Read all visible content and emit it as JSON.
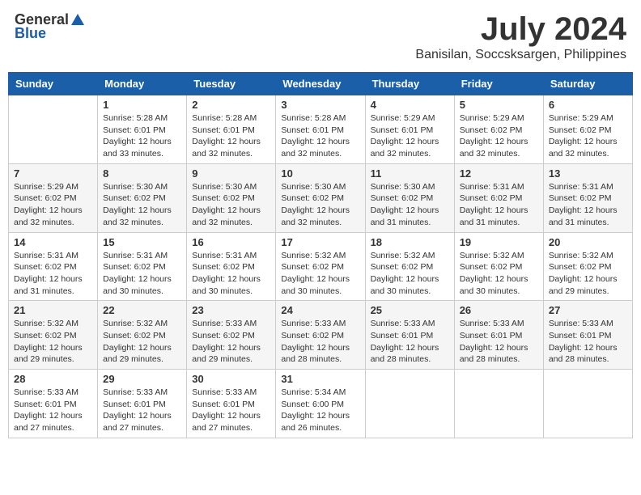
{
  "header": {
    "logo_general": "General",
    "logo_blue": "Blue",
    "month": "July 2024",
    "location": "Banisilan, Soccsksargen, Philippines"
  },
  "days_of_week": [
    "Sunday",
    "Monday",
    "Tuesday",
    "Wednesday",
    "Thursday",
    "Friday",
    "Saturday"
  ],
  "weeks": [
    [
      {
        "day": "",
        "sunrise": "",
        "sunset": "",
        "daylight": ""
      },
      {
        "day": "1",
        "sunrise": "Sunrise: 5:28 AM",
        "sunset": "Sunset: 6:01 PM",
        "daylight": "Daylight: 12 hours and 33 minutes."
      },
      {
        "day": "2",
        "sunrise": "Sunrise: 5:28 AM",
        "sunset": "Sunset: 6:01 PM",
        "daylight": "Daylight: 12 hours and 32 minutes."
      },
      {
        "day": "3",
        "sunrise": "Sunrise: 5:28 AM",
        "sunset": "Sunset: 6:01 PM",
        "daylight": "Daylight: 12 hours and 32 minutes."
      },
      {
        "day": "4",
        "sunrise": "Sunrise: 5:29 AM",
        "sunset": "Sunset: 6:01 PM",
        "daylight": "Daylight: 12 hours and 32 minutes."
      },
      {
        "day": "5",
        "sunrise": "Sunrise: 5:29 AM",
        "sunset": "Sunset: 6:02 PM",
        "daylight": "Daylight: 12 hours and 32 minutes."
      },
      {
        "day": "6",
        "sunrise": "Sunrise: 5:29 AM",
        "sunset": "Sunset: 6:02 PM",
        "daylight": "Daylight: 12 hours and 32 minutes."
      }
    ],
    [
      {
        "day": "7",
        "sunrise": "Sunrise: 5:29 AM",
        "sunset": "Sunset: 6:02 PM",
        "daylight": "Daylight: 12 hours and 32 minutes."
      },
      {
        "day": "8",
        "sunrise": "Sunrise: 5:30 AM",
        "sunset": "Sunset: 6:02 PM",
        "daylight": "Daylight: 12 hours and 32 minutes."
      },
      {
        "day": "9",
        "sunrise": "Sunrise: 5:30 AM",
        "sunset": "Sunset: 6:02 PM",
        "daylight": "Daylight: 12 hours and 32 minutes."
      },
      {
        "day": "10",
        "sunrise": "Sunrise: 5:30 AM",
        "sunset": "Sunset: 6:02 PM",
        "daylight": "Daylight: 12 hours and 32 minutes."
      },
      {
        "day": "11",
        "sunrise": "Sunrise: 5:30 AM",
        "sunset": "Sunset: 6:02 PM",
        "daylight": "Daylight: 12 hours and 31 minutes."
      },
      {
        "day": "12",
        "sunrise": "Sunrise: 5:31 AM",
        "sunset": "Sunset: 6:02 PM",
        "daylight": "Daylight: 12 hours and 31 minutes."
      },
      {
        "day": "13",
        "sunrise": "Sunrise: 5:31 AM",
        "sunset": "Sunset: 6:02 PM",
        "daylight": "Daylight: 12 hours and 31 minutes."
      }
    ],
    [
      {
        "day": "14",
        "sunrise": "Sunrise: 5:31 AM",
        "sunset": "Sunset: 6:02 PM",
        "daylight": "Daylight: 12 hours and 31 minutes."
      },
      {
        "day": "15",
        "sunrise": "Sunrise: 5:31 AM",
        "sunset": "Sunset: 6:02 PM",
        "daylight": "Daylight: 12 hours and 30 minutes."
      },
      {
        "day": "16",
        "sunrise": "Sunrise: 5:31 AM",
        "sunset": "Sunset: 6:02 PM",
        "daylight": "Daylight: 12 hours and 30 minutes."
      },
      {
        "day": "17",
        "sunrise": "Sunrise: 5:32 AM",
        "sunset": "Sunset: 6:02 PM",
        "daylight": "Daylight: 12 hours and 30 minutes."
      },
      {
        "day": "18",
        "sunrise": "Sunrise: 5:32 AM",
        "sunset": "Sunset: 6:02 PM",
        "daylight": "Daylight: 12 hours and 30 minutes."
      },
      {
        "day": "19",
        "sunrise": "Sunrise: 5:32 AM",
        "sunset": "Sunset: 6:02 PM",
        "daylight": "Daylight: 12 hours and 30 minutes."
      },
      {
        "day": "20",
        "sunrise": "Sunrise: 5:32 AM",
        "sunset": "Sunset: 6:02 PM",
        "daylight": "Daylight: 12 hours and 29 minutes."
      }
    ],
    [
      {
        "day": "21",
        "sunrise": "Sunrise: 5:32 AM",
        "sunset": "Sunset: 6:02 PM",
        "daylight": "Daylight: 12 hours and 29 minutes."
      },
      {
        "day": "22",
        "sunrise": "Sunrise: 5:32 AM",
        "sunset": "Sunset: 6:02 PM",
        "daylight": "Daylight: 12 hours and 29 minutes."
      },
      {
        "day": "23",
        "sunrise": "Sunrise: 5:33 AM",
        "sunset": "Sunset: 6:02 PM",
        "daylight": "Daylight: 12 hours and 29 minutes."
      },
      {
        "day": "24",
        "sunrise": "Sunrise: 5:33 AM",
        "sunset": "Sunset: 6:02 PM",
        "daylight": "Daylight: 12 hours and 28 minutes."
      },
      {
        "day": "25",
        "sunrise": "Sunrise: 5:33 AM",
        "sunset": "Sunset: 6:01 PM",
        "daylight": "Daylight: 12 hours and 28 minutes."
      },
      {
        "day": "26",
        "sunrise": "Sunrise: 5:33 AM",
        "sunset": "Sunset: 6:01 PM",
        "daylight": "Daylight: 12 hours and 28 minutes."
      },
      {
        "day": "27",
        "sunrise": "Sunrise: 5:33 AM",
        "sunset": "Sunset: 6:01 PM",
        "daylight": "Daylight: 12 hours and 28 minutes."
      }
    ],
    [
      {
        "day": "28",
        "sunrise": "Sunrise: 5:33 AM",
        "sunset": "Sunset: 6:01 PM",
        "daylight": "Daylight: 12 hours and 27 minutes."
      },
      {
        "day": "29",
        "sunrise": "Sunrise: 5:33 AM",
        "sunset": "Sunset: 6:01 PM",
        "daylight": "Daylight: 12 hours and 27 minutes."
      },
      {
        "day": "30",
        "sunrise": "Sunrise: 5:33 AM",
        "sunset": "Sunset: 6:01 PM",
        "daylight": "Daylight: 12 hours and 27 minutes."
      },
      {
        "day": "31",
        "sunrise": "Sunrise: 5:34 AM",
        "sunset": "Sunset: 6:00 PM",
        "daylight": "Daylight: 12 hours and 26 minutes."
      },
      {
        "day": "",
        "sunrise": "",
        "sunset": "",
        "daylight": ""
      },
      {
        "day": "",
        "sunrise": "",
        "sunset": "",
        "daylight": ""
      },
      {
        "day": "",
        "sunrise": "",
        "sunset": "",
        "daylight": ""
      }
    ]
  ]
}
